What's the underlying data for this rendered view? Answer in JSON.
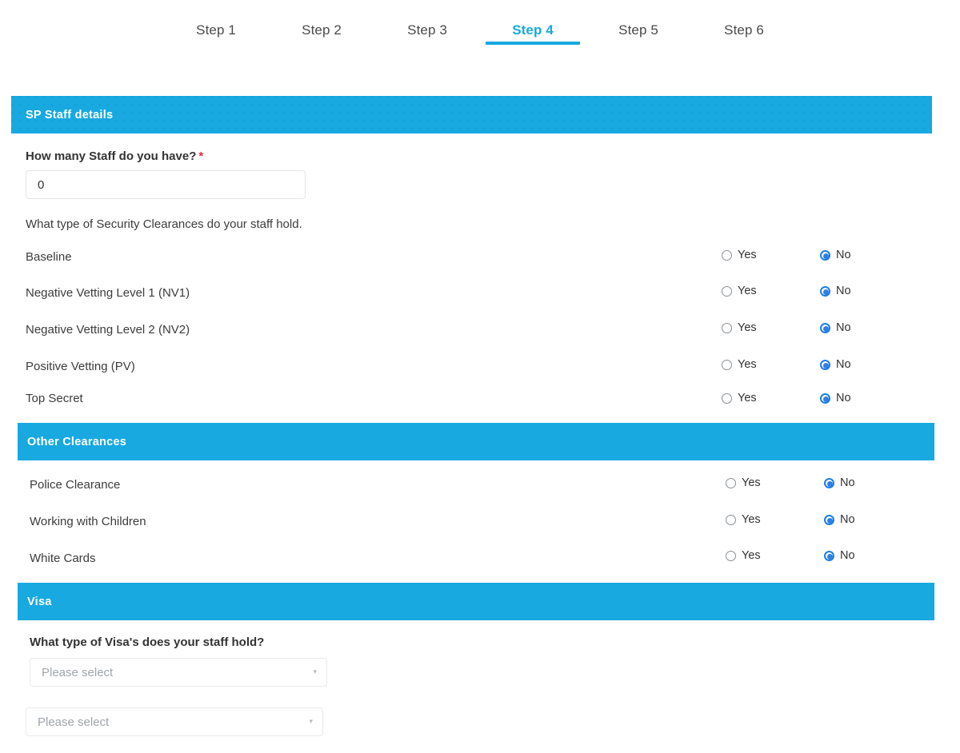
{
  "stepper": {
    "steps": [
      {
        "label": "Step 1",
        "active": false
      },
      {
        "label": "Step 2",
        "active": false
      },
      {
        "label": "Step 3",
        "active": false
      },
      {
        "label": "Step 4",
        "active": true
      },
      {
        "label": "Step 5",
        "active": false
      },
      {
        "label": "Step 6",
        "active": false
      }
    ]
  },
  "colors": {
    "accent": "#17a9e0",
    "radio_selected": "#2e7fe8",
    "required_asterisk": "#e8273f",
    "text": "#3c3c3c"
  },
  "staff_section": {
    "header": "SP Staff details",
    "staff_count_label": "How many Staff do you have?",
    "required_marker": "*",
    "staff_count_value": "0",
    "staff_count_placeholder": "0",
    "clearance_question": "What type of Security Clearances do your staff hold.",
    "yes_label": "Yes",
    "no_label": "No",
    "rows": [
      {
        "label": "Baseline",
        "value": "No"
      },
      {
        "label": "Negative Vetting Level 1 (NV1)",
        "value": "No"
      },
      {
        "label": "Negative Vetting Level 2 (NV2)",
        "value": "No"
      },
      {
        "label": "Positive Vetting (PV)",
        "value": "No"
      },
      {
        "label": "Top Secret",
        "value": "No"
      }
    ]
  },
  "other_clearances": {
    "header": "Other Clearances",
    "yes_label": "Yes",
    "no_label": "No",
    "rows": [
      {
        "label": "Police Clearance",
        "value": "No"
      },
      {
        "label": "Working with Children",
        "value": "No"
      },
      {
        "label": "White Cards",
        "value": "No"
      }
    ]
  },
  "visa": {
    "header": "Visa",
    "question": "What type of Visa's does your staff hold?",
    "selects": [
      {
        "value": "Please select",
        "caret": "▾"
      },
      {
        "value": "Please select",
        "caret": "▾"
      }
    ]
  }
}
